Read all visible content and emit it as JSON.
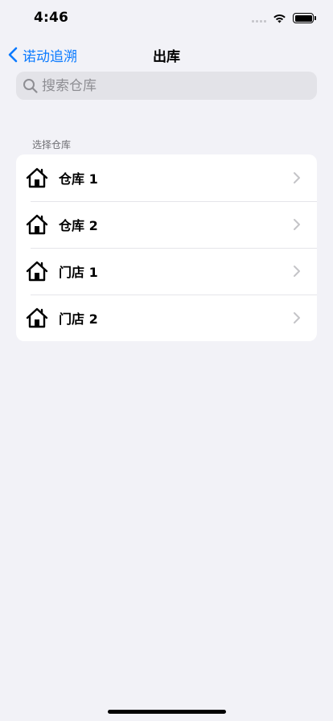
{
  "status_bar": {
    "time": "4:46"
  },
  "nav": {
    "back_label": "诺动追溯",
    "title": "出库"
  },
  "search": {
    "placeholder": "搜索仓库",
    "value": ""
  },
  "section": {
    "header": "选择仓库",
    "items": [
      {
        "label": "仓库 1",
        "icon": "house-icon"
      },
      {
        "label": "仓库 2",
        "icon": "house-icon"
      },
      {
        "label": "门店 1",
        "icon": "house-icon"
      },
      {
        "label": "门店 2",
        "icon": "house-icon"
      }
    ]
  },
  "colors": {
    "accent": "#0a7aff",
    "background": "#f2f2f7"
  }
}
